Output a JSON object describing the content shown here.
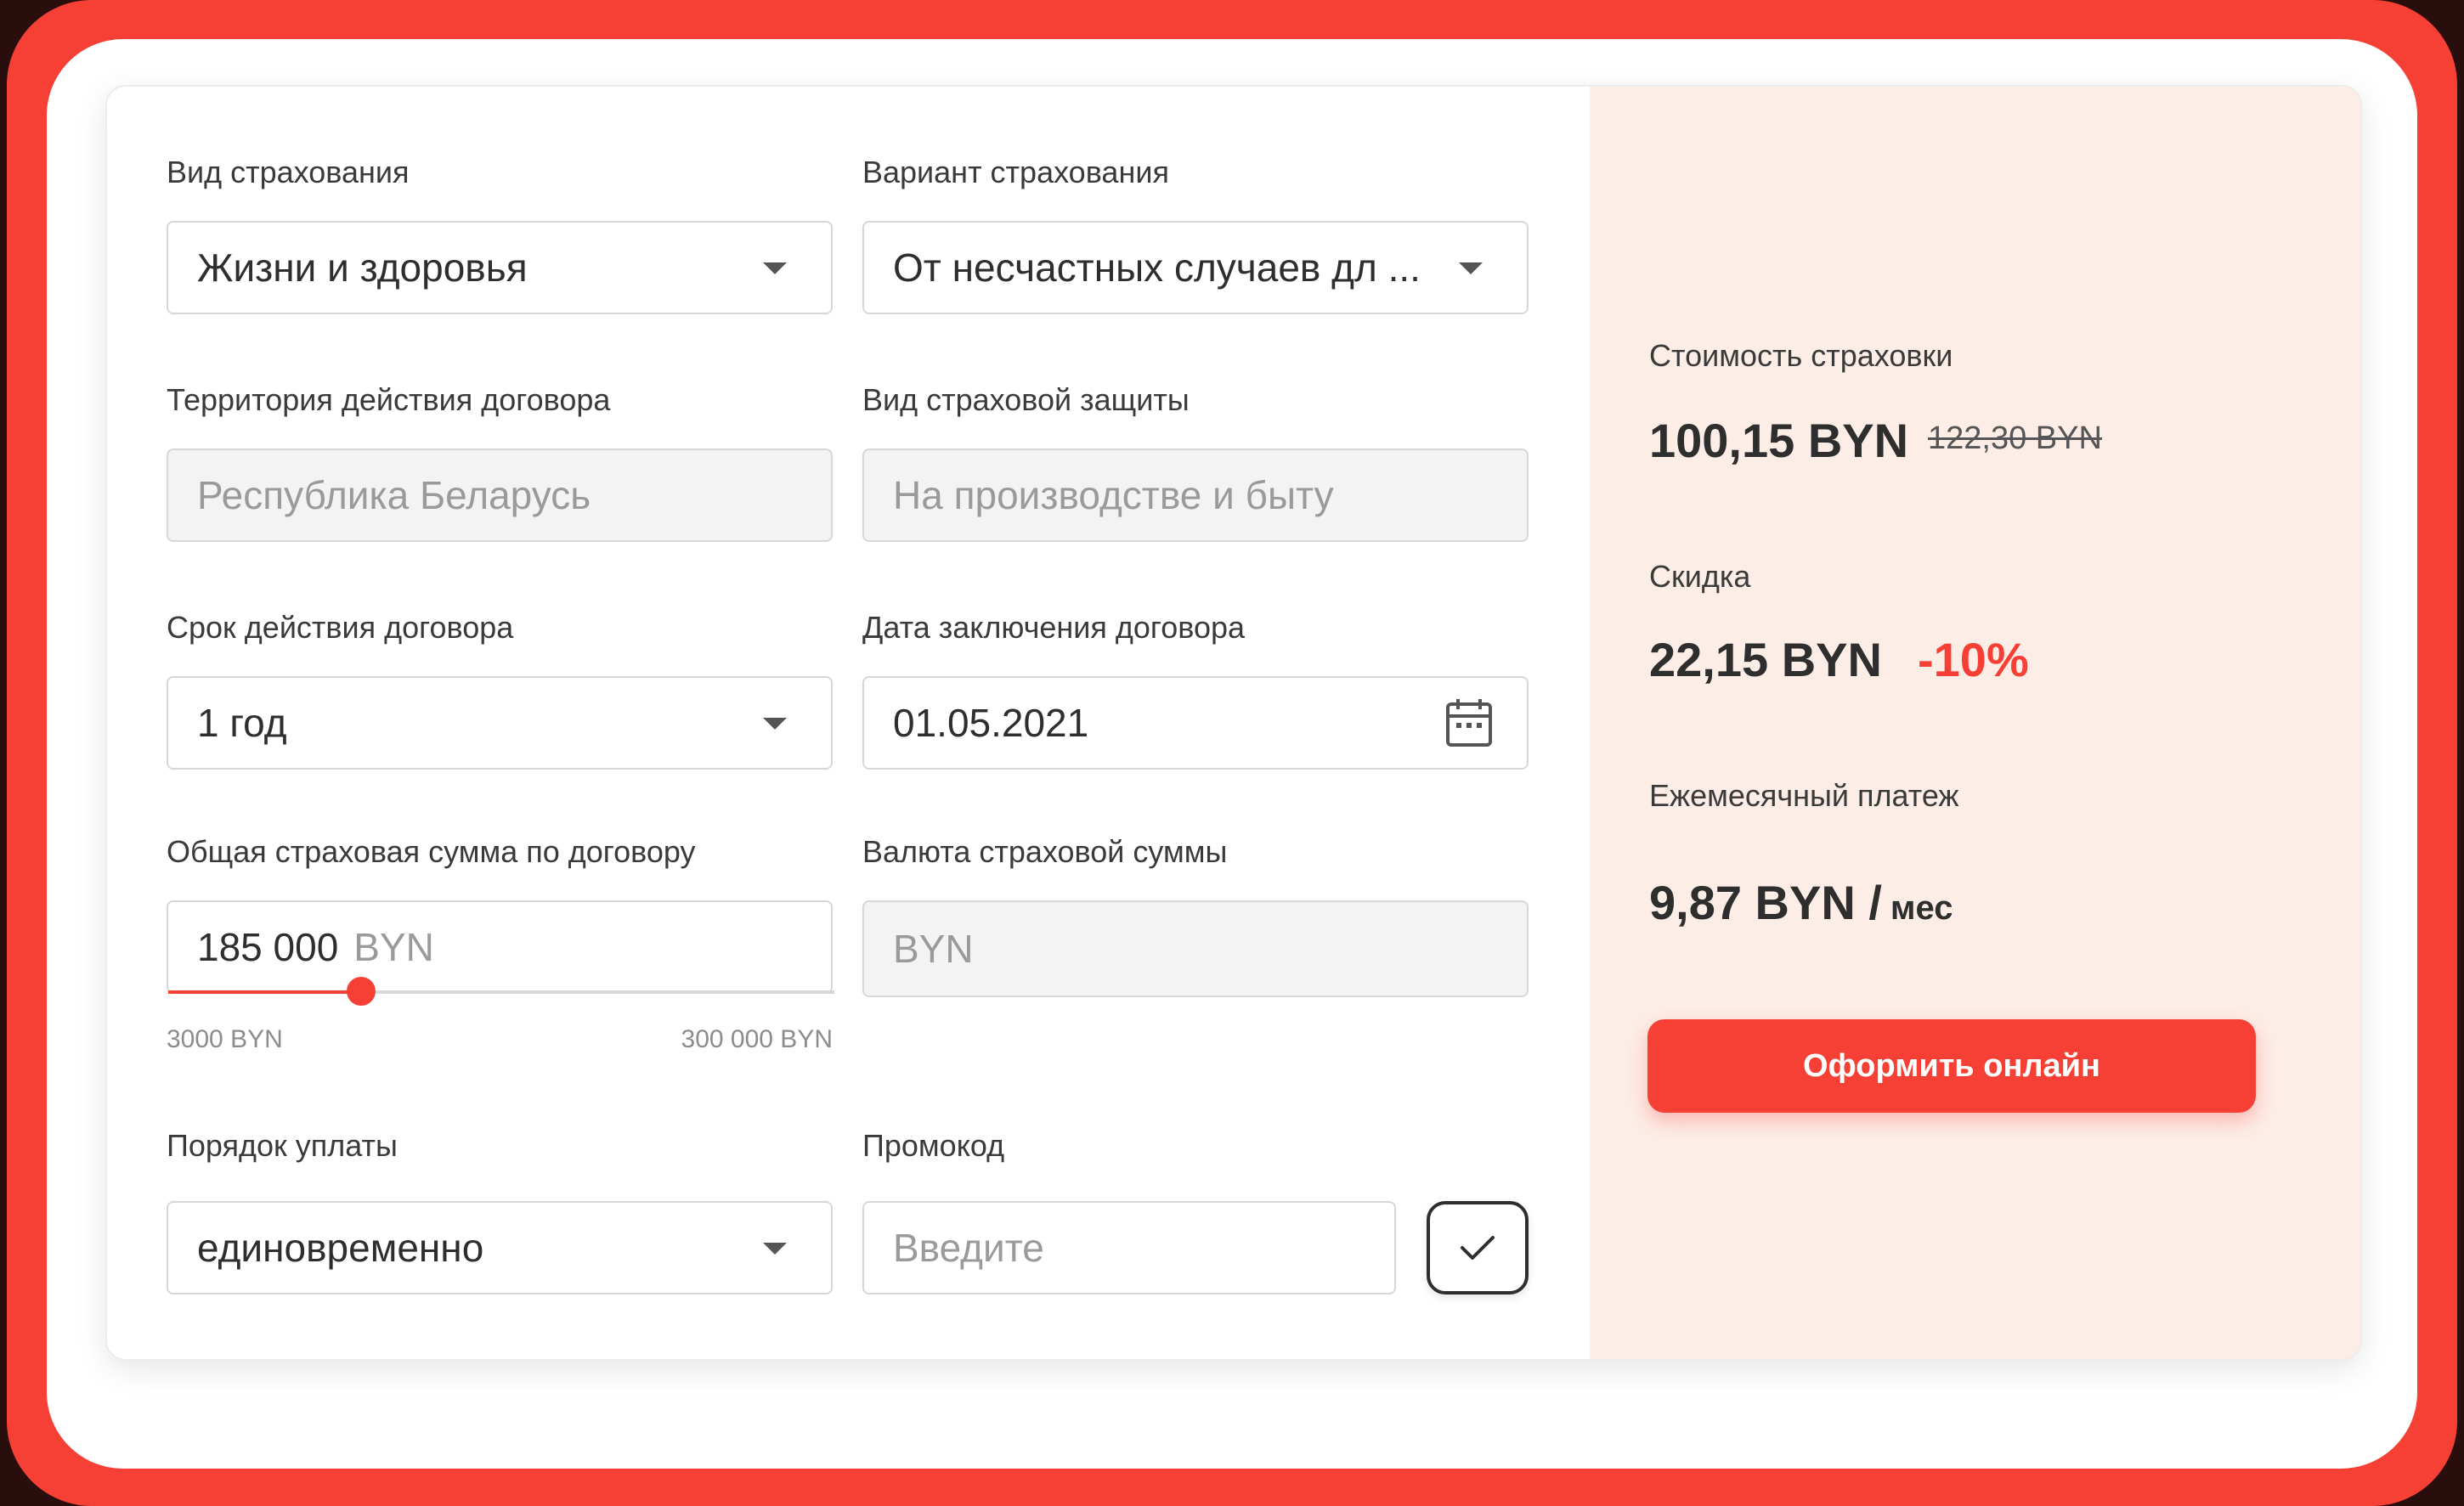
{
  "form": {
    "insurance_type": {
      "label": "Вид страхования",
      "value": "Жизни и здоровья"
    },
    "insurance_variant": {
      "label": "Вариант страхования",
      "value": "От несчастных случаев дл ..."
    },
    "territory": {
      "label": "Территория действия договора",
      "value": "Республика Беларусь"
    },
    "protection_type": {
      "label": "Вид страховой защиты",
      "value": "На производстве и быту"
    },
    "term": {
      "label": "Срок действия договора",
      "value": "1 год"
    },
    "contract_date": {
      "label": "Дата заключения договора",
      "value": "01.05.2021"
    },
    "sum_insured": {
      "label": "Общая страховая сумма по договору",
      "value": "185 000",
      "unit": "BYN",
      "min_label": "3000 BYN",
      "max_label": "300 000 BYN",
      "slider_fraction": 0.29
    },
    "currency": {
      "label": "Валюта страховой суммы",
      "value": "BYN"
    },
    "payment_order": {
      "label": "Порядок уплаты",
      "value": "единовременно"
    },
    "promo": {
      "label": "Промокод",
      "placeholder": "Введите"
    }
  },
  "summary": {
    "cost_label": "Стоимость страховки",
    "cost_value": "100,15 BYN",
    "cost_old": "122,30 BYN",
    "discount_label": "Скидка",
    "discount_value": "22,15 BYN",
    "discount_pct": "-10%",
    "monthly_label": "Ежемесячный платеж",
    "monthly_value": "9,87 BYN /",
    "monthly_unit": "мес",
    "cta_label": "Оформить онлайн"
  },
  "colors": {
    "accent": "#f64035",
    "panel": "#fcede6"
  },
  "icons": [
    "chevron-down-icon",
    "calendar-icon",
    "check-icon"
  ]
}
